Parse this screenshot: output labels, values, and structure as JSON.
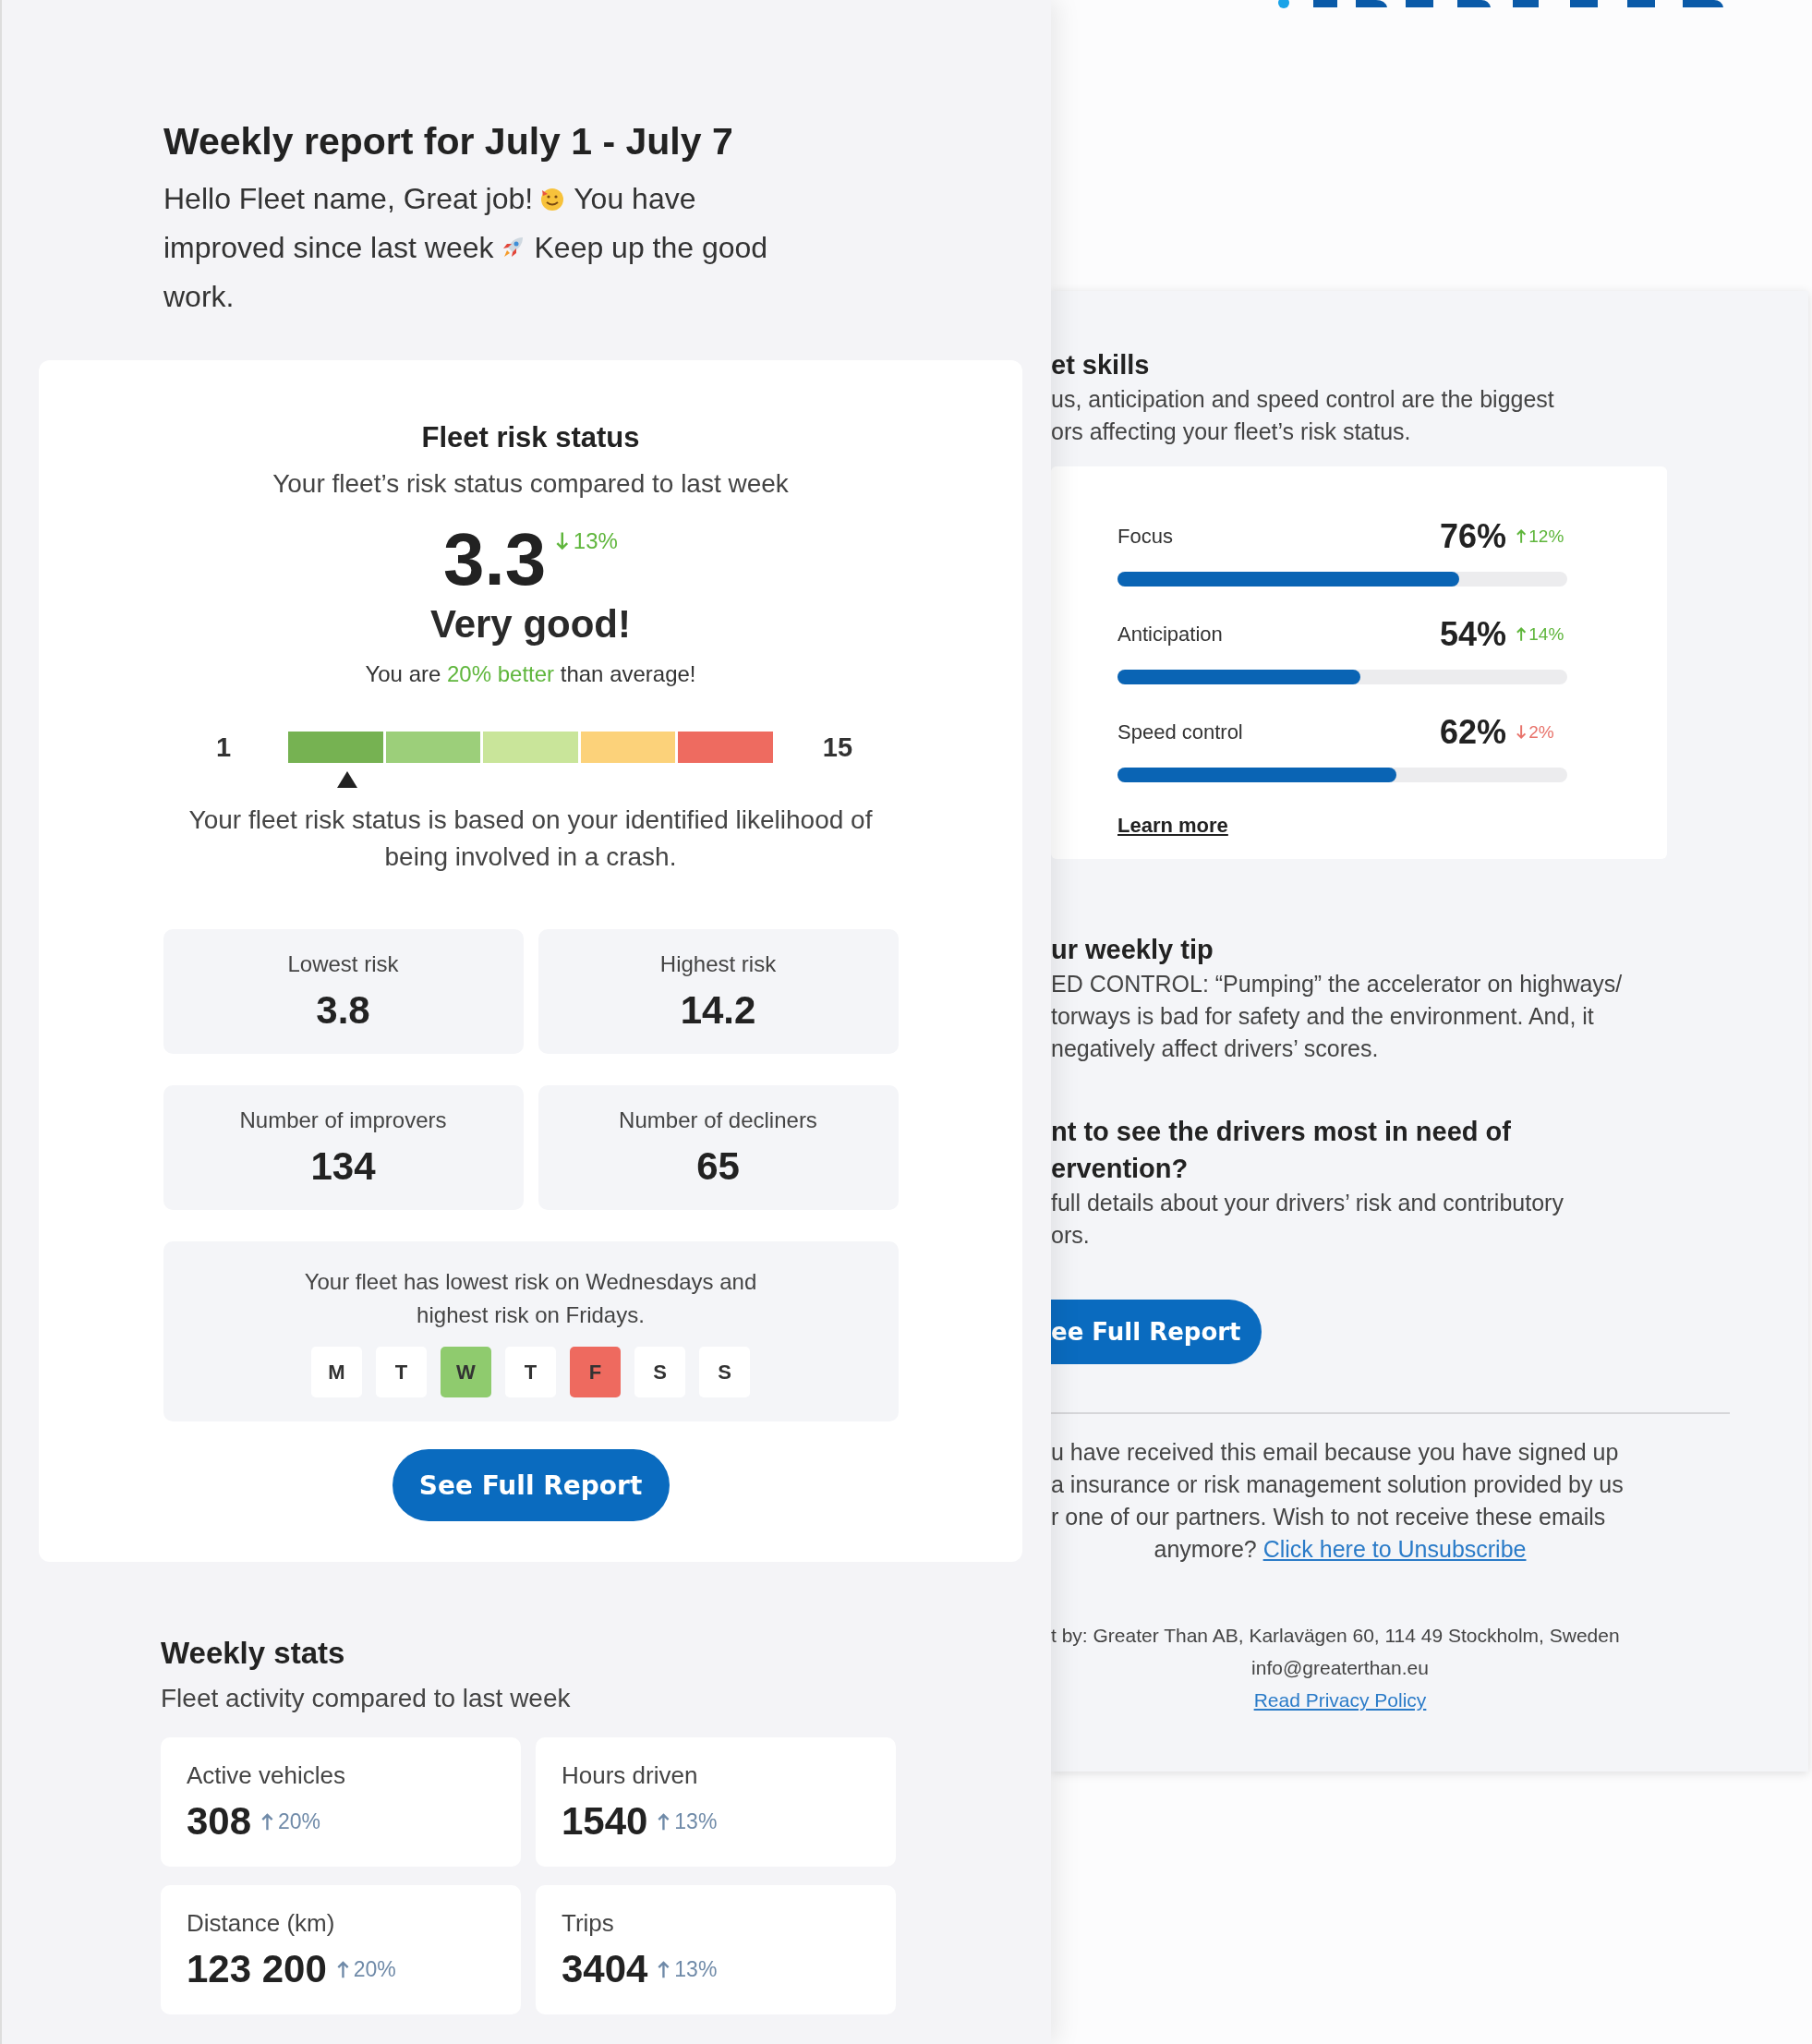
{
  "report": {
    "title": "Weekly report for July 1 - July 7",
    "greeting": [
      [
        "Hello Fleet name, Great job!",
        "You have"
      ],
      [
        "improved since last week",
        "Keep up the good"
      ],
      [
        "work."
      ]
    ],
    "risk": {
      "title": "Fleet risk status",
      "subtitle": "Your fleet’s risk status compared to last week",
      "score": "3.3",
      "change": {
        "rising": false,
        "color": "#5fb63c",
        "text": "13%"
      },
      "rating": "Very good!",
      "comparison": "You are **20% better** than average!",
      "scale": {
        "min": "1",
        "max": "15",
        "segments": [
          {
            "color": "#76b252",
            "selected": true
          },
          {
            "color": "#9ccf7a",
            "selected": false
          },
          {
            "color": "#c9e59a",
            "selected": false
          },
          {
            "color": "#fcd27a",
            "selected": false
          },
          {
            "color": "#ee6b60",
            "selected": false
          }
        ]
      },
      "note": "Your fleet risk status is based on your identified likelihood of being involved in a crash.",
      "tiles": [
        {
          "label": "Lowest risk",
          "value": "3.8"
        },
        {
          "label": "Highest risk",
          "value": "14.2"
        },
        {
          "label": "Number of improvers",
          "value": "134"
        },
        {
          "label": "Number of decliners",
          "value": "65"
        }
      ],
      "days_text": "Your fleet has lowest risk on Wednesdays and highest risk on Fridays.",
      "days": [
        {
          "label": "M",
          "color": "#ffffff"
        },
        {
          "label": "T",
          "color": "#ffffff"
        },
        {
          "label": "W",
          "color": "#8fcb6e"
        },
        {
          "label": "T",
          "color": "#ffffff"
        },
        {
          "label": "F",
          "color": "#ee6a5f"
        },
        {
          "label": "S",
          "color": "#ffffff"
        },
        {
          "label": "S",
          "color": "#ffffff"
        }
      ],
      "button": "See Full Report"
    },
    "weekly": {
      "title": "Weekly stats",
      "subtitle": "Fleet activity compared to last week",
      "items": [
        {
          "label": "Active vehicles",
          "value": "308",
          "change": {
            "rising": true,
            "color": "#6f8aa8",
            "text": "20%"
          }
        },
        {
          "label": "Hours driven",
          "value": "1540",
          "change": {
            "rising": true,
            "color": "#6f8aa8",
            "text": "13%"
          }
        },
        {
          "label": "Distance (km)",
          "value": "123 200",
          "change": {
            "rising": true,
            "color": "#6f8aa8",
            "text": "20%"
          }
        },
        {
          "label": "Trips",
          "value": "3404",
          "change": {
            "rising": true,
            "color": "#6f8aa8",
            "text": "13%"
          }
        }
      ]
    }
  },
  "email": {
    "skills": {
      "title": "et skills",
      "description": [
        "us, anticipation and speed control are the biggest",
        "ors affecting your fleet’s risk status."
      ],
      "items": [
        {
          "label": "Focus",
          "value": "76%",
          "level": 0.76,
          "change": {
            "rising": true,
            "color": "#5fb63c",
            "text": "12%"
          }
        },
        {
          "label": "Anticipation",
          "value": "54%",
          "level": 0.54,
          "change": {
            "rising": true,
            "color": "#5fb63c",
            "text": "14%"
          }
        },
        {
          "label": "Speed control",
          "value": "62%",
          "level": 0.62,
          "change": {
            "rising": false,
            "color": "#e8736b",
            "text": "2%"
          }
        }
      ],
      "link": "Learn more"
    },
    "tip": {
      "title": "ur weekly tip",
      "lines": [
        "ED CONTROL: “Pumping” the accelerator on highways/",
        "torways is bad for safety and the environment. And, it",
        "negatively affect drivers’ scores."
      ]
    },
    "cta": {
      "title": [
        "nt to see the drivers most in need of",
        "ervention?"
      ],
      "lines": [
        "full details about your drivers’ risk and contributory",
        "ors."
      ],
      "button": "ee Full Report"
    },
    "footer": {
      "notice": [
        "u have received this email because you have signed up",
        "a insurance or risk management solution provided by us",
        "r one of our partners. Wish to not receive these emails"
      ],
      "notice_end": "anymore?",
      "unsubscribe": "Click here to Unsubscribe",
      "address": "t by: Greater Than AB, Karlavägen 60, 114 49 Stockholm, Sweden",
      "email": "info@greaterthan.eu",
      "privacy": "Read Privacy Policy"
    }
  }
}
